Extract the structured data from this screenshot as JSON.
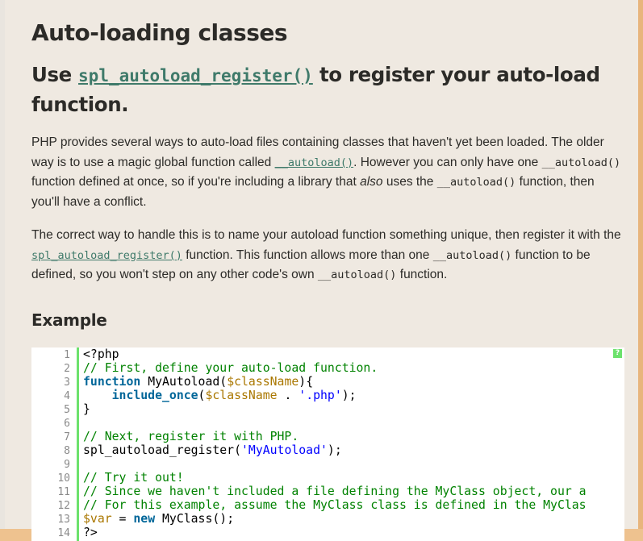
{
  "article": {
    "title": "Auto-loading classes",
    "subtitle": {
      "prefix": "Use ",
      "link": "spl_autoload_register()",
      "suffix": " to register your auto-load function."
    },
    "para1": {
      "t1": "PHP provides several ways to auto-load files containing classes that haven't yet been loaded. The older way is to use a magic global function called ",
      "link": "__autoload()",
      "t2": ". However you can only have one ",
      "code1": "__autoload()",
      "t3": " function defined at once, so if you're including a library that ",
      "em": "also",
      "t4": " uses the ",
      "code2": "__autoload()",
      "t5": " function, then you'll have a conflict."
    },
    "para2": {
      "t1": "The correct way to handle this is to name your autoload function something unique, then register it with the ",
      "link": "spl_autoload_register()",
      "t2": " function. This function allows more than one ",
      "code1": "__autoload()",
      "t3": " function to be defined, so you won't step on any other code's own ",
      "code2": "__autoload()",
      "t4": " function."
    },
    "example_heading": "Example"
  },
  "code": {
    "help_label": "?",
    "line_numbers": [
      "1",
      "2",
      "3",
      "4",
      "5",
      "6",
      "7",
      "8",
      "9",
      "10",
      "11",
      "12",
      "13",
      "14"
    ],
    "lines": {
      "l1": "<?php",
      "l2": "// First, define your auto-load function.",
      "l3_kw": "function",
      "l3_a": " MyAutoload(",
      "l3_var": "$className",
      "l3_b": "){",
      "l4_indent": "    ",
      "l4_kw": "include_once",
      "l4_a": "(",
      "l4_var": "$className",
      "l4_b": " . ",
      "l4_str": "'.php'",
      "l4_c": ");",
      "l5": "}",
      "l7": "// Next, register it with PHP.",
      "l8_a": "spl_autoload_register(",
      "l8_str": "'MyAutoload'",
      "l8_b": ");",
      "l10": "// Try it out!",
      "l11": "// Since we haven't included a file defining the MyClass object, our a",
      "l12": "// For this example, assume the MyClass class is defined in the MyClas",
      "l13_var": "$var",
      "l13_a": " = ",
      "l13_kw": "new",
      "l13_b": " MyClass();",
      "l14": "?>"
    }
  }
}
